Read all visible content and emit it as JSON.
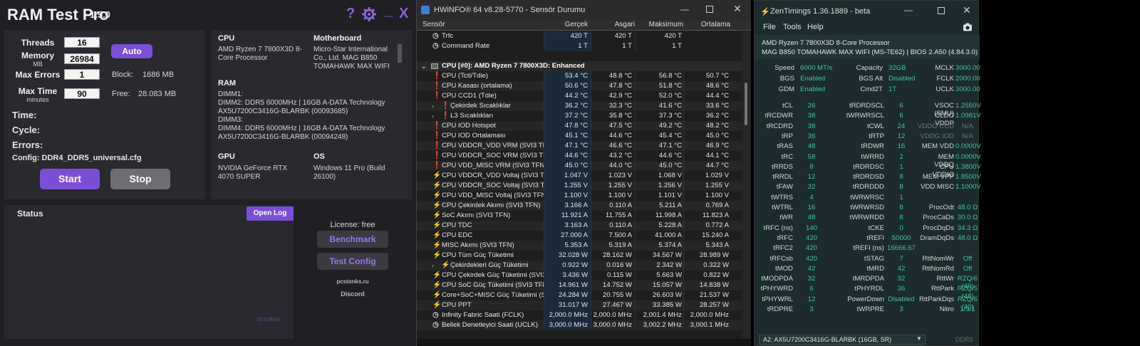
{
  "rtp": {
    "title": "RAM Test Pro",
    "version": "1.5.0",
    "help_icon": "?",
    "gear_icon": "gear",
    "min_icon": "_",
    "close_icon": "X",
    "threads_label": "Threads",
    "threads": "16",
    "memory_label": "Memory",
    "memory_unit": "MB",
    "memory": "26984",
    "maxerr_label": "Max Errors",
    "maxerr": "1",
    "maxtime_label": "Max Time",
    "maxtime_unit": "minutes",
    "maxtime": "90",
    "auto": "Auto",
    "block_label": "Block:",
    "block": "1686 MB",
    "free_label": "Free:",
    "free": "28.083 MB",
    "time_label": "Time:",
    "cycle_label": "Cycle:",
    "errors_label": "Errors:",
    "config": "Config: DDR4_DDR5_universal.cfg",
    "start": "Start",
    "stop": "Stop",
    "cpu_h": "CPU",
    "cpu": "AMD Ryzen 7 7800X3D 8-Core Processor",
    "mb_h": "Motherboard",
    "mb": "Micro-Star International Co., Ltd. MAG B850 TOMAHAWK MAX WIFI",
    "ram_h": "RAM",
    "ram_lines": [
      "DIMM1:",
      "DIMM2: DDR5 6000MHz | 16GB A-DATA Technology",
      "AX5U7200C3416G-BLARBK (00093685)",
      "DIMM3:",
      "DIMM4: DDR5 6000MHz | 16GB A-DATA Technology",
      "AX5U7200C3416G-BLARBK (00094248)"
    ],
    "gpu_h": "GPU",
    "gpu": "NVIDIA GeForce RTX 4070 SUPER",
    "os_h": "OS",
    "os": "Windows 11 Pro (Build 26100)",
    "status": "Status",
    "openlog": "Open Log",
    "license": "License: free",
    "benchmark": "Benchmark",
    "testconfig": "Test Config",
    "site": "pcstonks.ru",
    "discord": "Discord",
    "scrollbar": "Scrollbar"
  },
  "hw": {
    "title": "HWiNFO® 64 v8.28-5770 - Sensör Durumu",
    "cols": [
      "Sensör",
      "Gerçek",
      "Asgari",
      "Maksimum",
      "Ortalama"
    ],
    "group": "CPU [#0]: AMD Ryzen 7 7800X3D: Enhanced",
    "rows_top": [
      {
        "icon": "clock",
        "n": "Trfc",
        "v": [
          "420 T",
          "420 T",
          "420 T",
          ""
        ]
      },
      {
        "icon": "clock",
        "n": "Command Rate",
        "v": [
          "1 T",
          "1 T",
          "1 T",
          ""
        ]
      }
    ],
    "rows": [
      {
        "icon": "temp",
        "n": "CPU (Tctl/Tdie)",
        "v": [
          "53.4 °C",
          "48.8 °C",
          "56.8 °C",
          "50.7 °C"
        ]
      },
      {
        "icon": "temp",
        "n": "CPU Kasası (ortalama)",
        "v": [
          "50.6 °C",
          "47.8 °C",
          "51.8 °C",
          "48.6 °C"
        ]
      },
      {
        "icon": "temp",
        "n": "CPU CCD1 (Tdie)",
        "v": [
          "44.2 °C",
          "42.9 °C",
          "52.0 °C",
          "44.4 °C"
        ]
      },
      {
        "icon": "temp",
        "n": "Çekirdek Sıcaklıklar",
        "v": [
          "36.2 °C",
          "32.3 °C",
          "41.6 °C",
          "33.6 °C"
        ],
        "sub": true
      },
      {
        "icon": "temp",
        "n": "L3 Sıcaklıkları",
        "v": [
          "37.2 °C",
          "35.8 °C",
          "37.3 °C",
          "36.2 °C"
        ],
        "sub": true
      },
      {
        "icon": "temp",
        "n": "CPU IOD Hotspot",
        "v": [
          "47.8 °C",
          "47.5 °C",
          "49.2 °C",
          "48.2 °C"
        ]
      },
      {
        "icon": "temp",
        "n": "CPU IOD Ortalaması",
        "v": [
          "45.1 °C",
          "44.6 °C",
          "45.4 °C",
          "45.0 °C"
        ]
      },
      {
        "icon": "temp",
        "n": "CPU VDDCR_VDD VRM (SVI3 TFN)",
        "v": [
          "47.1 °C",
          "46.6 °C",
          "47.1 °C",
          "46.9 °C"
        ]
      },
      {
        "icon": "temp",
        "n": "CPU VDDCR_SOC VRM (SVI3 TFN)",
        "v": [
          "44.6 °C",
          "43.2 °C",
          "44.6 °C",
          "44.1 °C"
        ]
      },
      {
        "icon": "temp",
        "n": "CPU VDD_MISC VRM (SVI3 TFN)",
        "v": [
          "45.0 °C",
          "44.0 °C",
          "45.0 °C",
          "44.7 °C"
        ]
      },
      {
        "icon": "volt",
        "n": "CPU VDDCR_VDD Voltaj (SVI3 TFN)",
        "v": [
          "1.047 V",
          "1.023 V",
          "1.068 V",
          "1.029 V"
        ]
      },
      {
        "icon": "volt",
        "n": "CPU VDDCR_SOC Voltaj (SVI3 TFN)",
        "v": [
          "1.255 V",
          "1.255 V",
          "1.256 V",
          "1.255 V"
        ]
      },
      {
        "icon": "volt",
        "n": "CPU VDD_MISC Voltaj (SVI3 TFN)",
        "v": [
          "1.100 V",
          "1.100 V",
          "1.101 V",
          "1.100 V"
        ]
      },
      {
        "icon": "volt",
        "n": "CPU Çekirdek Akımı (SVI3 TFN)",
        "v": [
          "3.166 A",
          "0.110 A",
          "5.211 A",
          "0.769 A"
        ]
      },
      {
        "icon": "volt",
        "n": "SoC Akımı (SVI3 TFN)",
        "v": [
          "11.921 A",
          "11.755 A",
          "11.998 A",
          "11.823 A"
        ]
      },
      {
        "icon": "volt",
        "n": "CPU TDC",
        "v": [
          "3.163 A",
          "0.110 A",
          "5.228 A",
          "0.772 A"
        ]
      },
      {
        "icon": "volt",
        "n": "CPU EDC",
        "v": [
          "27.000 A",
          "7.500 A",
          "41.000 A",
          "15.240 A"
        ]
      },
      {
        "icon": "volt",
        "n": "MISC Akımı (SVI3 TFN)",
        "v": [
          "5.353 A",
          "5.319 A",
          "5.374 A",
          "5.343 A"
        ]
      },
      {
        "icon": "volt",
        "n": "CPU Tüm Güç Tüketimi",
        "v": [
          "32.028 W",
          "28.162 W",
          "34.567 W",
          "28.989 W"
        ]
      },
      {
        "icon": "volt",
        "n": "Çekirdekleri Güç Tüketimi",
        "v": [
          "0.922 W",
          "0.016 W",
          "2.342 W",
          "0.322 W"
        ],
        "sub": true
      },
      {
        "icon": "volt",
        "n": "CPU Çekirdek Güç Tüketimi (SVI3 ...",
        "v": [
          "3.436 W",
          "0.115 W",
          "5.663 W",
          "0.822 W"
        ]
      },
      {
        "icon": "volt",
        "n": "CPU SoC Güç Tüketimi (SVI3 TFN)",
        "v": [
          "14.961 W",
          "14.752 W",
          "15.057 W",
          "14.838 W"
        ]
      },
      {
        "icon": "volt",
        "n": "Core+SoC+MISC Güç Tüketimi (S...",
        "v": [
          "24.284 W",
          "20.755 W",
          "26.603 W",
          "21.537 W"
        ]
      },
      {
        "icon": "volt",
        "n": "CPU PPT",
        "v": [
          "31.017 W",
          "27.467 W",
          "33.385 W",
          "28.257 W"
        ]
      },
      {
        "icon": "clock",
        "n": "Infinity Fabric Saati (FCLK)",
        "v": [
          "2,000.0 MHz",
          "2,000.0 MHz",
          "2,001.4 MHz",
          "2,000.0 MHz"
        ]
      },
      {
        "icon": "clock",
        "n": "Bellek Denetleyici Saati (UCLK)",
        "v": [
          "3,000.0 MHz",
          "3,000.0 MHz",
          "3,002.2 MHz",
          "3,000.1 MHz"
        ]
      }
    ]
  },
  "zt": {
    "title": "ZenTimings 1.36.1889 - beta",
    "menu": [
      "File",
      "Tools",
      "Help"
    ],
    "cpu": "AMD Ryzen 7 7800X3D 8-Core Processor",
    "board": "MAG B850 TOMAHAWK MAX WIFI (MS-7E62) | BIOS 2.A50 (4.84.3.0)",
    "top": [
      [
        "Speed",
        "6000 MT/s",
        "Capacity",
        "32GB",
        "MCLK",
        "3000.00"
      ],
      [
        "BGS",
        "Enabled",
        "BGS Alt",
        "Disabled",
        "FCLK",
        "2000.00"
      ],
      [
        "GDM",
        "Enabled",
        "Cmd2T",
        "1T",
        "UCLK",
        "3000.00"
      ]
    ],
    "grid": [
      [
        "tCL",
        "26",
        "tRDRDSCL",
        "6",
        "VSOC (SMU)",
        "1.2550V"
      ],
      [
        "tRCDWR",
        "38",
        "tWRWRSCL",
        "6",
        "CLDO VDDP",
        "1.0981V"
      ],
      [
        "tRCDRD",
        "38",
        "tCWL",
        "24",
        "VDDG CCD",
        "N/A"
      ],
      [
        "tRP",
        "36",
        "tRTP",
        "12",
        "VDDG IOD",
        "N/A"
      ],
      [
        "tRAS",
        "48",
        "tRDWR",
        "16",
        "MEM VDD",
        "0.0000V"
      ],
      [
        "tRC",
        "58",
        "tWRRD",
        "2",
        "MEM VDDQ",
        "0.0000V"
      ],
      [
        "tRRDS",
        "8",
        "tRDRDSC",
        "1",
        "CPU VDDIO",
        "1.3800V"
      ],
      [
        "tRRDL",
        "12",
        "tRDRDSD",
        "8",
        "MEM VPP",
        "1.8500V"
      ],
      [
        "tFAW",
        "32",
        "tRDRDDD",
        "8",
        "VDD MISC",
        "1.1000V"
      ],
      [
        "tWTRS",
        "4",
        "tWRWRSC",
        "1",
        "",
        ""
      ],
      [
        "tWTRL",
        "16",
        "tWRWRSD",
        "8",
        "ProcOdt",
        "48.0 Ω"
      ],
      [
        "tWR",
        "48",
        "tWRWRDD",
        "8",
        "ProcCaDs",
        "30.0 Ω"
      ],
      [
        "tRFC (ns)",
        "140",
        "tCKE",
        "0",
        "ProcDqDs",
        "34.3 Ω"
      ],
      [
        "tRFC",
        "420",
        "tREFI",
        "50000",
        "DramDqDs",
        "48.0 Ω"
      ],
      [
        "tRFC2",
        "420",
        "tREFI (ns)",
        "16666.67",
        "",
        ""
      ],
      [
        "tRFCsb",
        "420",
        "tSTAG",
        "7",
        "RttNomWr",
        "Off"
      ],
      [
        "tMOD",
        "42",
        "tMRD",
        "42",
        "RttNomRd",
        "Off"
      ],
      [
        "tMODPDA",
        "32",
        "tMRDPDA",
        "32",
        "RttWr",
        "RZQ/6 (40)"
      ],
      [
        "tPHYWRD",
        "6",
        "tPHYRDL",
        "36",
        "RttPark",
        "RZQ/5 (48)"
      ],
      [
        "tPHYWRL",
        "12",
        "PowerDown",
        "Disabled",
        "RttParkDqs",
        "RZQ/6 (40)"
      ],
      [
        "tRDPRE",
        "3",
        "tWRPRE",
        "3",
        "Nitro",
        "1/3/1"
      ]
    ],
    "dimm": "A2: AX5U7200C3416G-BLARBK (16GB, SR)",
    "dimm_type": "DDR5"
  }
}
